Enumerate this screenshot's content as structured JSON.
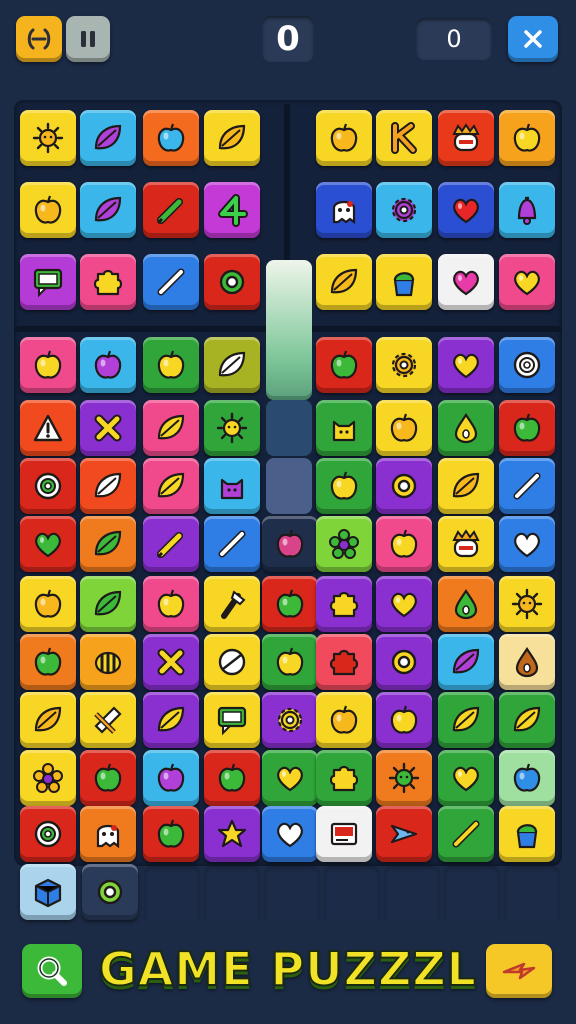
{
  "top": {
    "menu_icon": "swap-icon",
    "pause_icon": "pause-icon",
    "level_value": "0",
    "score_value": "0",
    "close_icon": "close-icon"
  },
  "footer": {
    "search_icon": "search-icon",
    "title": "GAME PUZZZL",
    "share_icon": "share-icon"
  },
  "colors": {
    "background": "#1b2a45",
    "title": "#f2e227",
    "menu_button": "#f5b41e",
    "pause_button": "#a9b5b0",
    "close_button": "#2f8fe6",
    "search_button": "#3db93a",
    "share_button": "#f5c828"
  },
  "tray": [
    {
      "bg": "#a9d4ec",
      "icon": "box"
    },
    {
      "bg": "#2a3b5a",
      "icon": "ring"
    }
  ],
  "tiles": [
    [
      {
        "bg": "#f7d724",
        "icon": "sun"
      },
      {
        "bg": "#3ab6ea",
        "icon": "leaf"
      },
      {
        "bg": "#f46a1e",
        "icon": "apple"
      },
      {
        "bg": "#f7d724",
        "icon": "leaf"
      },
      null,
      {
        "bg": "#f7d724",
        "icon": "apple"
      },
      {
        "bg": "#f7d724",
        "icon": "k"
      },
      {
        "bg": "#e83a1a",
        "icon": "face"
      },
      {
        "bg": "#f7a21d",
        "icon": "apple"
      }
    ],
    [
      {
        "bg": "#f7d724",
        "icon": "apple"
      },
      {
        "bg": "#3ab6ea",
        "icon": "leaf"
      },
      {
        "bg": "#d9271b",
        "icon": "pen"
      },
      {
        "bg": "#c33ad6",
        "icon": "four"
      },
      null,
      {
        "bg": "#2b4fd2",
        "icon": "ghost"
      },
      {
        "bg": "#3ab6ea",
        "icon": "gear"
      },
      {
        "bg": "#2b4fd2",
        "icon": "heart"
      },
      {
        "bg": "#3ab6ea",
        "icon": "bell"
      }
    ],
    [
      {
        "bg": "#b53bd6",
        "icon": "chat"
      },
      {
        "bg": "#f04a8c",
        "icon": "puzzle"
      },
      {
        "bg": "#2f7ee6",
        "icon": "wand"
      },
      {
        "bg": "#d9271b",
        "icon": "ring"
      },
      null,
      {
        "bg": "#f7d724",
        "icon": "leaf"
      },
      {
        "bg": "#f7d724",
        "icon": "cup"
      },
      {
        "bg": "#f2f2f2",
        "icon": "heart"
      },
      {
        "bg": "#f04a8c",
        "icon": "heart"
      }
    ],
    [
      {
        "bg": "#f04a8c",
        "icon": "apple"
      },
      {
        "bg": "#3ab6ea",
        "icon": "apple"
      },
      {
        "bg": "#2fa53a",
        "icon": "apple"
      },
      {
        "bg": "#a8b324",
        "icon": "leaf"
      },
      null,
      {
        "bg": "#d9271b",
        "icon": "apple"
      },
      {
        "bg": "#f7d724",
        "icon": "gear"
      },
      {
        "bg": "#8a2fd0",
        "icon": "heart"
      },
      {
        "bg": "#2f7ee6",
        "icon": "target"
      }
    ],
    [
      {
        "bg": "#f04a1e",
        "icon": "warn"
      },
      {
        "bg": "#8a2fd0",
        "icon": "x"
      },
      {
        "bg": "#f04a8c",
        "icon": "leaf"
      },
      {
        "bg": "#2fa53a",
        "icon": "sun"
      },
      null,
      {
        "bg": "#2fa53a",
        "icon": "cat"
      },
      {
        "bg": "#f7d724",
        "icon": "apple"
      },
      {
        "bg": "#2fa53a",
        "icon": "drop"
      },
      {
        "bg": "#d9271b",
        "icon": "apple"
      }
    ],
    [
      {
        "bg": "#d9271b",
        "icon": "target"
      },
      {
        "bg": "#f04a1e",
        "icon": "leaf"
      },
      {
        "bg": "#f04a8c",
        "icon": "leaf"
      },
      {
        "bg": "#3ab6ea",
        "icon": "cat"
      },
      null,
      {
        "bg": "#2fa53a",
        "icon": "apple"
      },
      {
        "bg": "#8a2fd0",
        "icon": "ring"
      },
      {
        "bg": "#f7d724",
        "icon": "leaf"
      },
      {
        "bg": "#2f7ee6",
        "icon": "wand"
      }
    ],
    [
      {
        "bg": "#d9271b",
        "icon": "heart"
      },
      {
        "bg": "#f07a1e",
        "icon": "leaf"
      },
      {
        "bg": "#8a2fd0",
        "icon": "pen"
      },
      {
        "bg": "#2f7ee6",
        "icon": "wand"
      },
      {
        "bg": "#1f2e4b",
        "icon": "apple"
      },
      {
        "bg": "#7fd43a",
        "icon": "flower"
      },
      {
        "bg": "#f04a8c",
        "icon": "apple"
      },
      {
        "bg": "#f7d724",
        "icon": "face"
      },
      {
        "bg": "#2f7ee6",
        "icon": "heart"
      }
    ],
    [
      {
        "bg": "#f7d724",
        "icon": "apple"
      },
      {
        "bg": "#7fd43a",
        "icon": "leaf"
      },
      {
        "bg": "#f04a8c",
        "icon": "apple"
      },
      {
        "bg": "#f7d724",
        "icon": "axe"
      },
      {
        "bg": "#d9271b",
        "icon": "apple"
      },
      {
        "bg": "#8a2fd0",
        "icon": "puzzle"
      },
      {
        "bg": "#8a2fd0",
        "icon": "heart"
      },
      {
        "bg": "#f07a1e",
        "icon": "drop"
      },
      {
        "bg": "#f7d724",
        "icon": "sun"
      }
    ],
    [
      {
        "bg": "#f07a1e",
        "icon": "apple"
      },
      {
        "bg": "#f7a21d",
        "icon": "bee"
      },
      {
        "bg": "#8a2fd0",
        "icon": "x"
      },
      {
        "bg": "#f7d724",
        "icon": "ball"
      },
      {
        "bg": "#2fa53a",
        "icon": "apple"
      },
      {
        "bg": "#f04a5c",
        "icon": "puzzle"
      },
      {
        "bg": "#8a2fd0",
        "icon": "ring"
      },
      {
        "bg": "#3ab6ea",
        "icon": "leaf"
      },
      {
        "bg": "#f7e09a",
        "icon": "drop"
      }
    ],
    [
      {
        "bg": "#f7d724",
        "icon": "leaf"
      },
      {
        "bg": "#f7d724",
        "icon": "tape"
      },
      {
        "bg": "#8a2fd0",
        "icon": "leaf"
      },
      {
        "bg": "#f7d724",
        "icon": "chat"
      },
      {
        "bg": "#8a2fd0",
        "icon": "gear"
      },
      {
        "bg": "#f7d724",
        "icon": "apple"
      },
      {
        "bg": "#8a2fd0",
        "icon": "apple"
      },
      {
        "bg": "#2fa53a",
        "icon": "leaf"
      },
      {
        "bg": "#2fa53a",
        "icon": "leaf"
      }
    ],
    [
      {
        "bg": "#f7d724",
        "icon": "flower"
      },
      {
        "bg": "#d9271b",
        "icon": "apple"
      },
      {
        "bg": "#3ab6ea",
        "icon": "apple"
      },
      {
        "bg": "#d9271b",
        "icon": "apple"
      },
      {
        "bg": "#2fa53a",
        "icon": "heart"
      },
      {
        "bg": "#2fa53a",
        "icon": "puzzle"
      },
      {
        "bg": "#f07a1e",
        "icon": "sun"
      },
      {
        "bg": "#2fa53a",
        "icon": "heart"
      },
      {
        "bg": "#9fe0a0",
        "icon": "apple"
      }
    ],
    [
      {
        "bg": "#d9271b",
        "icon": "target"
      },
      {
        "bg": "#f07a1e",
        "icon": "ghost"
      },
      {
        "bg": "#d9271b",
        "icon": "apple"
      },
      {
        "bg": "#8a2fd0",
        "icon": "star"
      },
      {
        "bg": "#2f7ee6",
        "icon": "heart"
      },
      {
        "bg": "#f2f2f2",
        "icon": "card"
      },
      {
        "bg": "#d9271b",
        "icon": "fish"
      },
      {
        "bg": "#2fa53a",
        "icon": "wand"
      },
      {
        "bg": "#f7d724",
        "icon": "cup"
      }
    ]
  ]
}
